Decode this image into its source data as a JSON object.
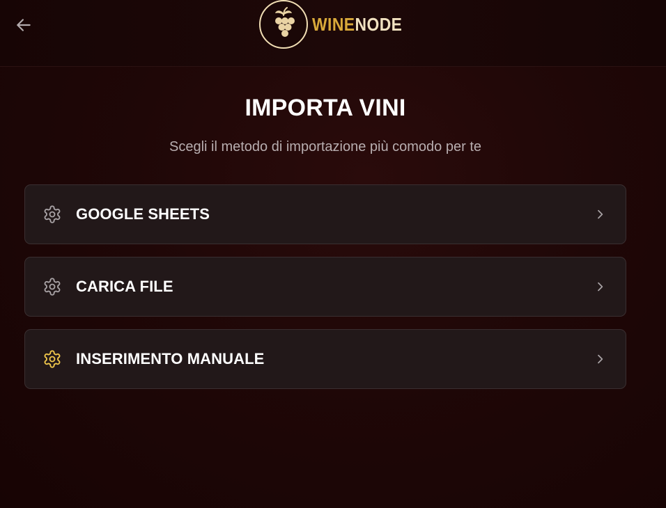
{
  "header": {
    "brand_part1": "WINE",
    "brand_part2": "NODE"
  },
  "page": {
    "title": "IMPORTA VINI",
    "subtitle": "Scegli il metodo di importazione più comodo per te"
  },
  "options": [
    {
      "label": "GOOGLE SHEETS",
      "icon": "gear-icon",
      "icon_color": "#a9a3a6"
    },
    {
      "label": "CARICA FILE",
      "icon": "gear-icon",
      "icon_color": "#a9a3a6"
    },
    {
      "label": "INSERIMENTO MANUALE",
      "icon": "gear-icon",
      "icon_color": "#f2c94c"
    }
  ],
  "colors": {
    "brand_gold": "#d9a93a",
    "brand_cream": "#f1e2c0",
    "card_bg": "#221819",
    "accent_yellow": "#f2c94c"
  }
}
